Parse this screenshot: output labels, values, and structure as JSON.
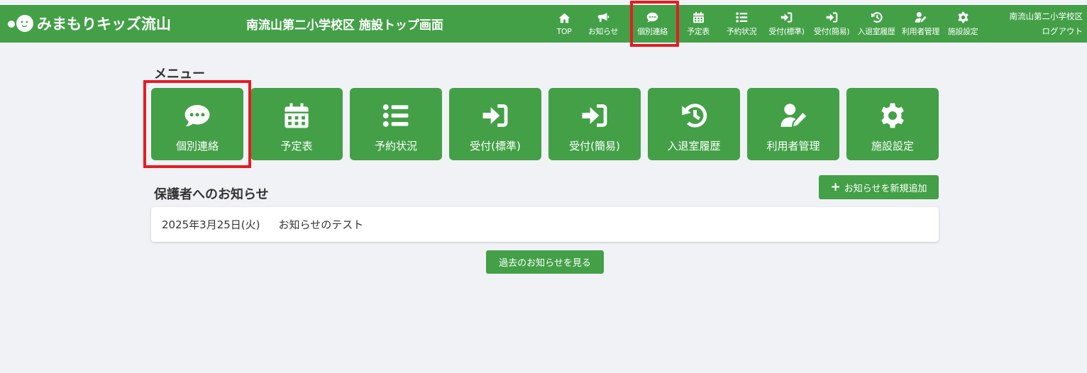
{
  "header": {
    "logo_text": "みまもりキッズ流山",
    "page_heading": "南流山第二小学校区 施設トップ画面",
    "facility_name": "南流山第二小学校区",
    "logout_label": "ログアウト",
    "accent_color": "#43a047"
  },
  "nav": {
    "items": [
      {
        "label": "TOP",
        "icon": "home-icon"
      },
      {
        "label": "お知らせ",
        "icon": "megaphone-icon"
      },
      {
        "label": "個別連絡",
        "icon": "speech-bubble-icon"
      },
      {
        "label": "予定表",
        "icon": "calendar-icon"
      },
      {
        "label": "予約状況",
        "icon": "list-icon"
      },
      {
        "label": "受付(標準)",
        "icon": "sign-in-icon"
      },
      {
        "label": "受付(簡易)",
        "icon": "sign-in-icon"
      },
      {
        "label": "入退室履歴",
        "icon": "history-icon"
      },
      {
        "label": "利用者管理",
        "icon": "user-edit-icon"
      },
      {
        "label": "施設設定",
        "icon": "gear-icon"
      }
    ]
  },
  "menu": {
    "title": "メニュー",
    "tiles": [
      {
        "label": "個別連絡",
        "icon": "speech-bubble-icon"
      },
      {
        "label": "予定表",
        "icon": "calendar-icon"
      },
      {
        "label": "予約状況",
        "icon": "list-icon"
      },
      {
        "label": "受付(標準)",
        "icon": "sign-in-icon"
      },
      {
        "label": "受付(簡易)",
        "icon": "sign-in-icon"
      },
      {
        "label": "入退室履歴",
        "icon": "history-icon"
      },
      {
        "label": "利用者管理",
        "icon": "user-edit-icon"
      },
      {
        "label": "施設設定",
        "icon": "gear-icon"
      }
    ]
  },
  "notices": {
    "title": "保護者へのお知らせ",
    "add_label": "お知らせを新規追加",
    "items": [
      {
        "date": "2025年3月25日(火)",
        "text": "お知らせのテスト"
      }
    ],
    "past_label": "過去のお知らせを見る"
  },
  "highlight_color": "#e51c23"
}
